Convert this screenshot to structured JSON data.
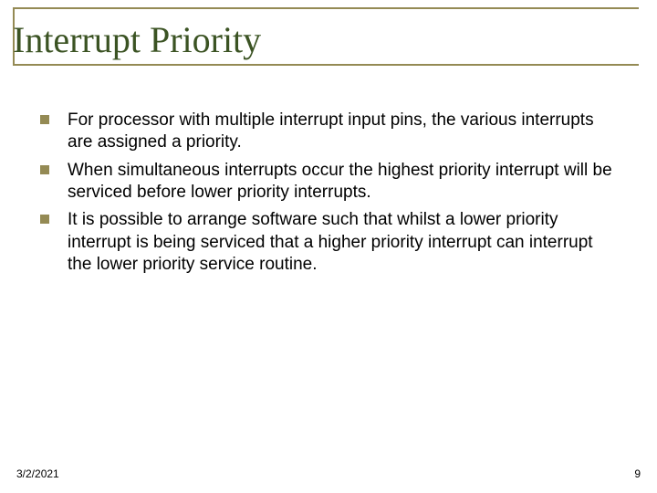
{
  "slide": {
    "title": "Interrupt Priority",
    "bullets": [
      "For processor with multiple interrupt input pins, the various interrupts are assigned a priority.",
      "When simultaneous interrupts occur the highest priority interrupt will be serviced before lower priority interrupts.",
      "It is possible to arrange software such that whilst a lower priority interrupt is being serviced that a higher priority interrupt can interrupt the lower priority service routine."
    ]
  },
  "footer": {
    "date": "3/2/2021",
    "page_number": "9"
  }
}
